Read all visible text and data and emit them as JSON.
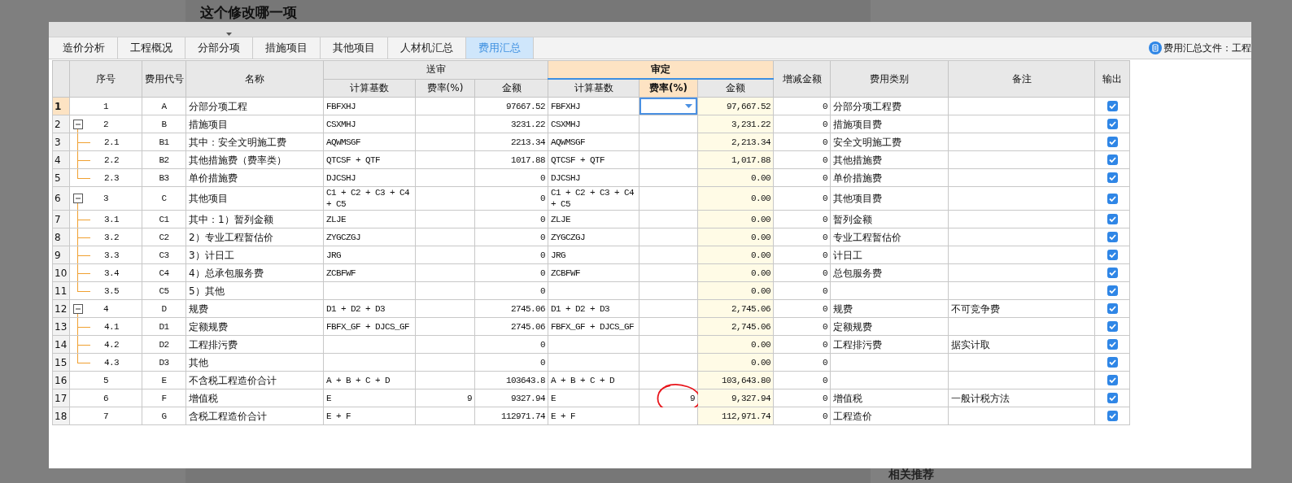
{
  "page": {
    "title": "这个修改哪一项",
    "bottom_heading": "相关推荐"
  },
  "tabs": [
    {
      "label": "造价分析",
      "selected": false
    },
    {
      "label": "工程概况",
      "selected": false
    },
    {
      "label": "分部分项",
      "selected": false
    },
    {
      "label": "措施项目",
      "selected": false
    },
    {
      "label": "其他项目",
      "selected": false
    },
    {
      "label": "人材机汇总",
      "selected": false
    },
    {
      "label": "费用汇总",
      "selected": true
    }
  ],
  "file_label": "费用汇总文件：工程",
  "table": {
    "columns": [
      {
        "label": "序号"
      },
      {
        "label": "费用代号"
      },
      {
        "label": "名称"
      },
      {
        "group": "送审",
        "highlighted": false,
        "sub": [
          {
            "label": "计算基数",
            "highlighted": false
          },
          {
            "label": "费率(%)",
            "highlighted": false
          },
          {
            "label": "金额",
            "highlighted": false
          }
        ]
      },
      {
        "group": "审定",
        "highlighted": true,
        "sub": [
          {
            "label": "计算基数",
            "highlighted": false
          },
          {
            "label": "费率(%)",
            "highlighted": true
          },
          {
            "label": "金额",
            "highlighted": false
          }
        ]
      },
      {
        "label": "增减金额"
      },
      {
        "label": "费用类别"
      },
      {
        "label": "备注"
      },
      {
        "label": "输出"
      }
    ],
    "rows": [
      {
        "row": "1",
        "seq": "1",
        "code": "A",
        "name": "分部分项工程",
        "sub_base": "FBFXHJ",
        "sub_amount": "97667.52",
        "app_base": "FBFXHJ",
        "app_amount": "97,667.52",
        "diff": "0",
        "category": "分部分项工程费",
        "output": true,
        "selected": true,
        "circled": false
      },
      {
        "row": "2",
        "seq": "2",
        "code": "B",
        "name": "措施项目",
        "sub_base": "CSXMHJ",
        "sub_amount": "3231.22",
        "app_base": "CSXMHJ",
        "app_amount": "3,231.22",
        "diff": "0",
        "category": "措施项目费",
        "output": true,
        "selected": false,
        "circled": false,
        "expanded": true,
        "children": [
          {
            "row": "3",
            "seq": "2.1",
            "code": "B1",
            "name": "其中：安全文明施工费",
            "sub_base": "AQWMSGF",
            "sub_amount": "2213.34",
            "app_base": "AQWMSGF",
            "app_amount": "2,213.34",
            "diff": "0",
            "category": "安全文明施工费",
            "output": true,
            "selected": false,
            "circled": false
          },
          {
            "row": "4",
            "seq": "2.2",
            "code": "B2",
            "name": "其他措施费（费率类）",
            "sub_base": "QTCSF + QTF",
            "sub_amount": "1017.88",
            "app_base": "QTCSF + QTF",
            "app_amount": "1,017.88",
            "diff": "0",
            "category": "其他措施费",
            "output": true,
            "selected": false,
            "circled": false
          },
          {
            "row": "5",
            "seq": "2.3",
            "code": "B3",
            "name": "单价措施费",
            "sub_base": "DJCSHJ",
            "sub_amount": "0",
            "app_base": "DJCSHJ",
            "app_amount": "0.00",
            "diff": "0",
            "category": "单价措施费",
            "output": true,
            "selected": false,
            "circled": false
          }
        ]
      },
      {
        "row": "6",
        "seq": "3",
        "code": "C",
        "name": "其他项目",
        "sub_base": "C1 + C2 + C3 + C4 + C5",
        "sub_amount": "0",
        "app_base": "C1 + C2 + C3 + C4 + C5",
        "app_amount": "0.00",
        "diff": "0",
        "category": "其他项目费",
        "output": true,
        "selected": false,
        "circled": false,
        "expanded": true,
        "children": [
          {
            "row": "7",
            "seq": "3.1",
            "code": "C1",
            "name": "其中：1）暂列金额",
            "sub_base": "ZLJE",
            "sub_amount": "0",
            "app_base": "ZLJE",
            "app_amount": "0.00",
            "diff": "0",
            "category": "暂列金额",
            "output": true,
            "selected": false,
            "circled": false
          },
          {
            "row": "8",
            "seq": "3.2",
            "code": "C2",
            "name": "2）专业工程暂估价",
            "sub_base": "ZYGCZGJ",
            "sub_amount": "0",
            "app_base": "ZYGCZGJ",
            "app_amount": "0.00",
            "diff": "0",
            "category": "专业工程暂估价",
            "output": true,
            "selected": false,
            "circled": false
          },
          {
            "row": "9",
            "seq": "3.3",
            "code": "C3",
            "name": "3）计日工",
            "sub_base": "JRG",
            "sub_amount": "0",
            "app_base": "JRG",
            "app_amount": "0.00",
            "diff": "0",
            "category": "计日工",
            "output": true,
            "selected": false,
            "circled": false
          },
          {
            "row": "10",
            "seq": "3.4",
            "code": "C4",
            "name": "4）总承包服务费",
            "sub_base": "ZCBFWF",
            "sub_amount": "0",
            "app_base": "ZCBFWF",
            "app_amount": "0.00",
            "diff": "0",
            "category": "总包服务费",
            "output": true,
            "selected": false,
            "circled": false
          },
          {
            "row": "11",
            "seq": "3.5",
            "code": "C5",
            "name": "5）其他",
            "sub_amount": "0",
            "app_amount": "0.00",
            "diff": "0",
            "output": true,
            "selected": false,
            "circled": false
          }
        ]
      },
      {
        "row": "12",
        "seq": "4",
        "code": "D",
        "name": "规费",
        "sub_base": "D1 + D2 + D3",
        "sub_amount": "2745.06",
        "app_base": "D1 + D2 + D3",
        "app_amount": "2,745.06",
        "diff": "0",
        "category": "规费",
        "note": "不可竞争费",
        "output": true,
        "selected": false,
        "circled": false,
        "expanded": true,
        "children": [
          {
            "row": "13",
            "seq": "4.1",
            "code": "D1",
            "name": "定额规费",
            "sub_base": "FBFX_GF + DJCS_GF",
            "sub_amount": "2745.06",
            "app_base": "FBFX_GF + DJCS_GF",
            "app_amount": "2,745.06",
            "diff": "0",
            "category": "定额规费",
            "output": true,
            "selected": false,
            "circled": false
          },
          {
            "row": "14",
            "seq": "4.2",
            "code": "D2",
            "name": "工程排污费",
            "sub_amount": "0",
            "app_amount": "0.00",
            "diff": "0",
            "category": "工程排污费",
            "note": "据实计取",
            "output": true,
            "selected": false,
            "circled": false
          },
          {
            "row": "15",
            "seq": "4.3",
            "code": "D3",
            "name": "其他",
            "sub_amount": "0",
            "app_amount": "0.00",
            "diff": "0",
            "output": true,
            "selected": false,
            "circled": false
          }
        ]
      },
      {
        "row": "16",
        "seq": "5",
        "code": "E",
        "name": "不含税工程造价合计",
        "sub_base": "A + B + C + D",
        "sub_amount": "103643.8",
        "app_base": "A + B + C + D",
        "app_amount": "103,643.80",
        "diff": "0",
        "output": true,
        "selected": false,
        "circled": false
      },
      {
        "row": "17",
        "seq": "6",
        "code": "F",
        "name": "增值税",
        "sub_base": "E",
        "sub_rate": "9",
        "sub_amount": "9327.94",
        "app_base": "E",
        "app_rate": "9",
        "app_amount": "9,327.94",
        "diff": "0",
        "category": "增值税",
        "note": "一般计税方法",
        "output": true,
        "selected": false,
        "circled": true
      },
      {
        "row": "18",
        "seq": "7",
        "code": "G",
        "name": "含税工程造价合计",
        "sub_base": "E + F",
        "sub_amount": "112971.74",
        "app_base": "E + F",
        "app_amount": "112,971.74",
        "diff": "0",
        "category": "工程造价",
        "output": true,
        "selected": false,
        "circled": false
      }
    ]
  }
}
